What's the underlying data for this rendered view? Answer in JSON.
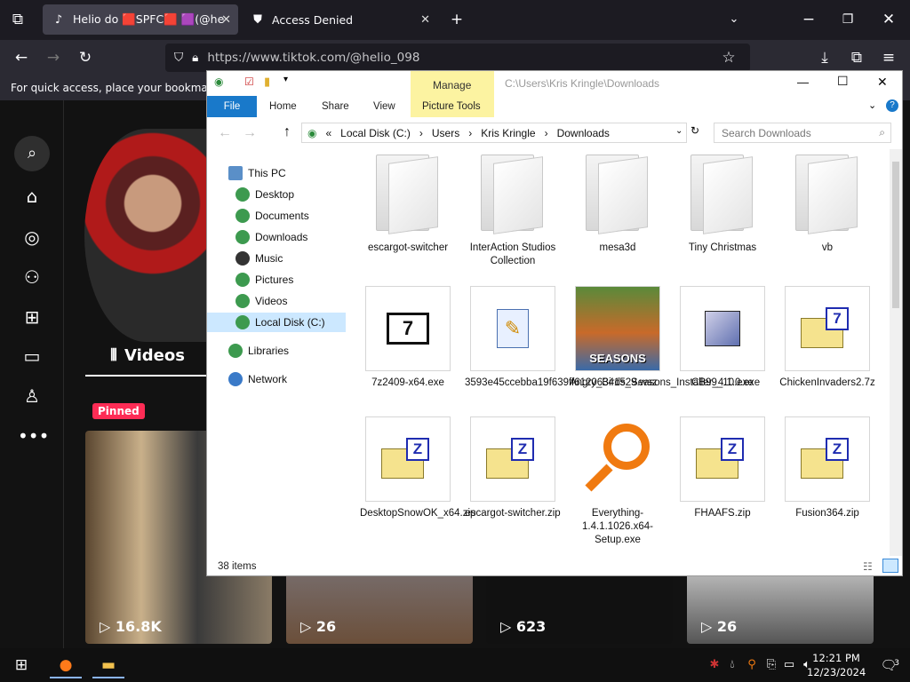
{
  "browser": {
    "tabs": [
      {
        "title": "Helio do 🟥SPFC🟥 🟪(@helio",
        "icon": "tiktok-icon",
        "active": true
      },
      {
        "title": "Access Denied",
        "icon": "shield-icon",
        "active": false
      }
    ],
    "url": "https://www.tiktok.com/@helio_098",
    "bookmark_hint": "For quick access, place your bookmarks h"
  },
  "tiktok": {
    "videos_tab": "Videos",
    "pinned_label": "Pinned",
    "view_counts": [
      "16.8K",
      "26",
      "623",
      "26"
    ]
  },
  "explorer": {
    "path": "C:\\Users\\Kris Kringle\\Downloads",
    "context_tab": "Manage",
    "ribbon_tabs": [
      "File",
      "Home",
      "Share",
      "View",
      "Picture Tools"
    ],
    "breadcrumb": [
      "Local Disk (C:)",
      "Users",
      "Kris Kringle",
      "Downloads"
    ],
    "search_placeholder": "Search Downloads",
    "nav": [
      "This PC",
      "Desktop",
      "Documents",
      "Downloads",
      "Music",
      "Pictures",
      "Videos",
      "Local Disk (C:)",
      "Libraries",
      "Network"
    ],
    "items": [
      "escargot-switcher",
      "InterAction Studios Collection",
      "mesa3d",
      "Tiny Christmas",
      "vb",
      "7z2409-x64.exe",
      "3593e45ccebba19f639ff61206341529.wsz",
      "Angry_Birds_Seasons_Installer_4.1.0.exe",
      "CB99_10.exe",
      "ChickenInvaders2.7z",
      "DesktopSnowOK_x64.zip",
      "escargot-switcher.zip",
      "Everything-1.4.1.1026.x64-Setup.exe",
      "FHAAFS.zip",
      "Fusion364.zip"
    ],
    "status": "38 items",
    "seasons_badge": "SEASONS"
  },
  "taskbar": {
    "time": "12:21 PM",
    "date": "12/23/2024",
    "notification_count": "3"
  }
}
